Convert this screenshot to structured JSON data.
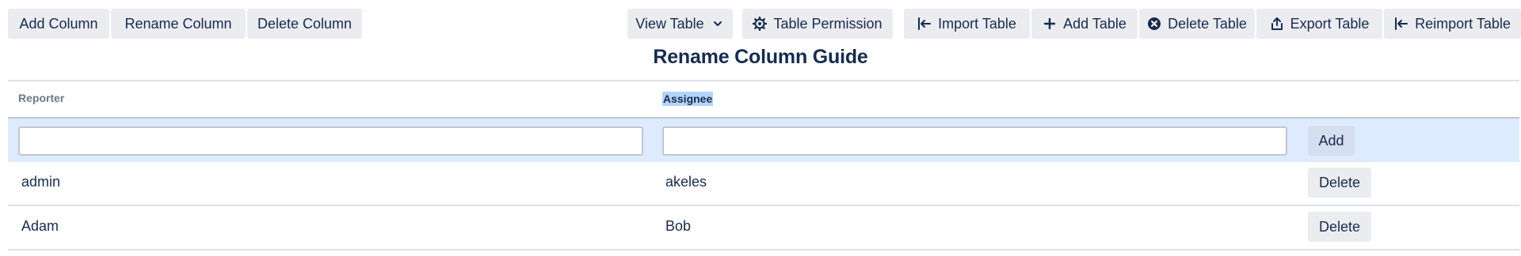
{
  "toolbar": {
    "left_buttons": [
      "Add Column",
      "Rename Column",
      "Delete Column"
    ],
    "view_table": "View Table",
    "table_permission": "Table Permission",
    "import_table": "Import Table",
    "add_table": "Add Table",
    "delete_table": "Delete Table",
    "export_table": "Export Table",
    "reimport_table": "Reimport Table"
  },
  "title": "Rename Column Guide",
  "table": {
    "columns": [
      "Reporter",
      "Assignee"
    ],
    "new_row": {
      "reporter_value": "",
      "assignee_value": "",
      "add_label": "Add"
    },
    "rows": [
      {
        "reporter": "admin",
        "assignee": "akeles",
        "delete_label": "Delete"
      },
      {
        "reporter": "Adam",
        "assignee": "Bob",
        "delete_label": "Delete"
      }
    ]
  },
  "colors": {
    "button_bg": "#ebecf0",
    "text": "#172b4d",
    "input_row_bg": "#deebff",
    "selection_highlight": "#b3d4fc"
  }
}
